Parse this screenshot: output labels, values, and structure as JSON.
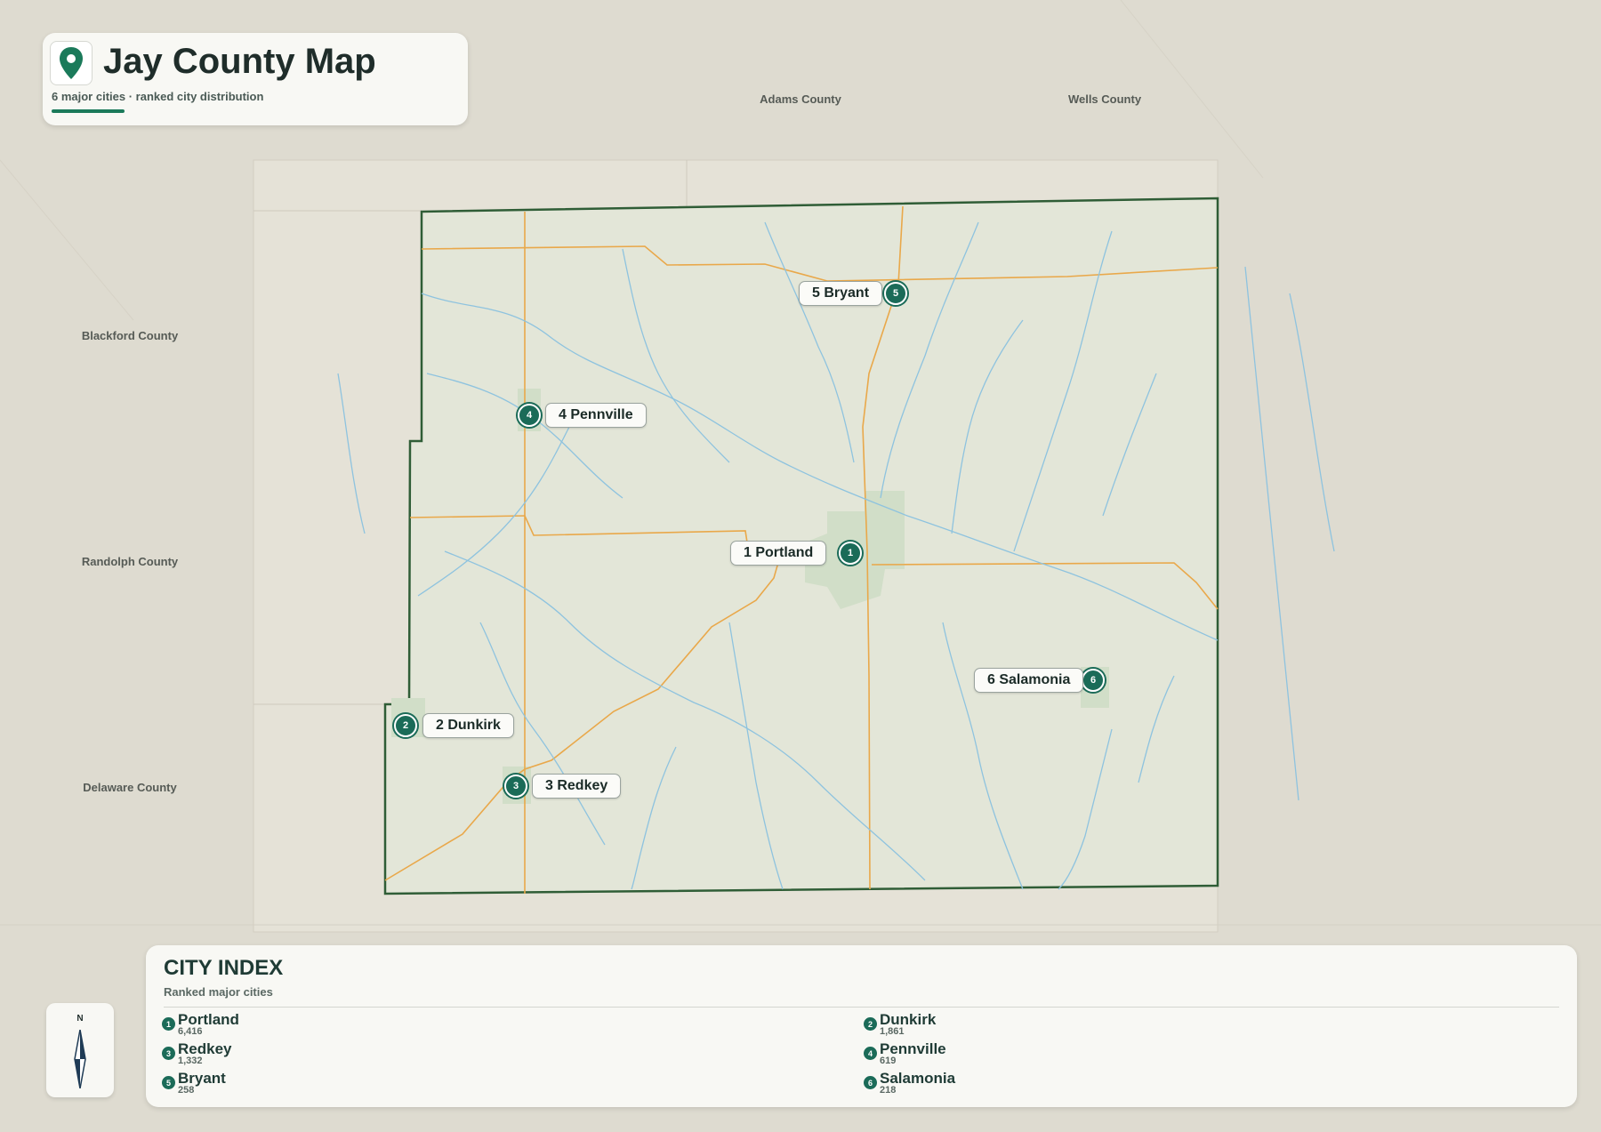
{
  "header": {
    "title": "Jay County Map",
    "subtitle": "6 major cities · ranked city distribution",
    "icon": "map-pin-icon"
  },
  "neighbors": [
    {
      "name": "Adams County"
    },
    {
      "name": "Wells County"
    },
    {
      "name": "Blackford County"
    },
    {
      "name": "Randolph County"
    },
    {
      "name": "Delaware County"
    }
  ],
  "cities": [
    {
      "rank": "1",
      "name": "Portland",
      "label": "1 Portland",
      "population": "6,416"
    },
    {
      "rank": "2",
      "name": "Dunkirk",
      "label": "2 Dunkirk",
      "population": "1,861"
    },
    {
      "rank": "3",
      "name": "Redkey",
      "label": "3 Redkey",
      "population": "1,332"
    },
    {
      "rank": "4",
      "name": "Pennville",
      "label": "4 Pennville",
      "population": "619"
    },
    {
      "rank": "5",
      "name": "Bryant",
      "label": "5 Bryant",
      "population": "258"
    },
    {
      "rank": "6",
      "name": "Salamonia",
      "label": "6 Salamonia",
      "population": "218"
    }
  ],
  "index_panel": {
    "title": "CITY INDEX",
    "subtitle": "Ranked major cities"
  },
  "compass": {
    "label": "N"
  },
  "colors": {
    "county_border": "#2f5d36",
    "rivers": "#8ec3df",
    "roads": "#e9a84a",
    "marker": "#1b6b58",
    "background": "#dedbd0"
  }
}
